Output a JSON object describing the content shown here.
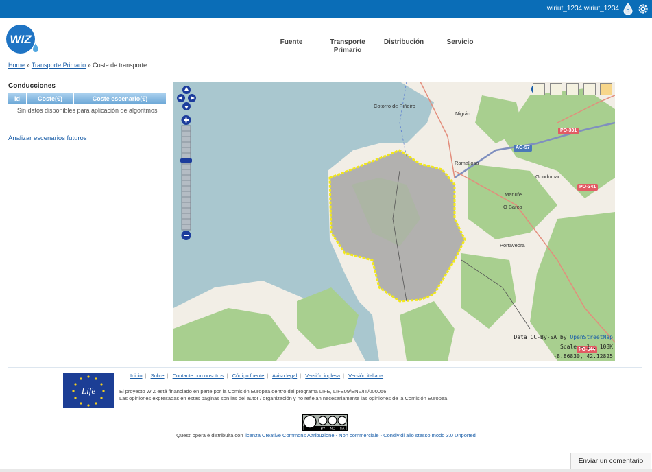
{
  "topbar": {
    "user": "wiriut_1234 wiriut_1234",
    "notification_count": "0",
    "color": "#0a6db7"
  },
  "brand": {
    "logo_text": "WIZ",
    "color": "#1f74c4"
  },
  "nav": [
    {
      "line1": "Fuente",
      "line2": ""
    },
    {
      "line1": "Transporte",
      "line2": "Primario"
    },
    {
      "line1": "Distribución",
      "line2": ""
    },
    {
      "line1": "Servicio",
      "line2": ""
    }
  ],
  "breadcrumb": {
    "home": "Home",
    "sep1": "»",
    "section": "Transporte Primario",
    "sep2": "»",
    "current": "Coste de transporte"
  },
  "conducciones": {
    "title": "Conducciones",
    "columns": [
      "Id",
      "Coste(€)",
      "Coste escenario(€)"
    ],
    "empty_message": "Sin datos disponibles para aplicación de algoritmos"
  },
  "analyze_link": "Analizar escenarios futuros",
  "map": {
    "labels": {
      "nigran": "Nigrán",
      "ramallosa": "Ramallosa",
      "gondomar": "Gondomar",
      "manufe": "Manufe",
      "o_barco": "O Barco",
      "portavedra": "Portavedra",
      "costa": "Cotorro de Piñeiro"
    },
    "roads": {
      "ag57": "AG-57",
      "po331": "PO-331",
      "po341": "PO-341",
      "po344": "PO-344"
    },
    "attribution_prefix": "Data CC-By-SA by",
    "attribution_link": "OpenStreetMap",
    "scale": "Scale = 1 : 108K",
    "coords": "-8.86830, 42.12825"
  },
  "footer": {
    "links": [
      "Inicio",
      "Sobre",
      "Contacte con nosotros",
      "Código fuente",
      "Aviso legal",
      "Versión inglesa",
      "Versión italiana"
    ],
    "life_logo_text": "Life",
    "funding": "El proyecto WIZ está financiado en parte por la Comisión Europea dentro del programa LIFE, LIFE09/ENV/IT/000056.",
    "disclaimer": "Las opiniones expresadas en estas páginas son las del autor / organización y no reflejan necesariamente las opiniones de la Comisión Europea.",
    "cc_labels": [
      "BY",
      "NC",
      "SA"
    ],
    "license_prefix": "Quest' opera è distribuita con",
    "license_link": "licenza Creative Commons Attribuzione - Non commerciale - Condividi allo stesso modo 3.0 Unported"
  },
  "feedback_button": "Enviar un comentario"
}
